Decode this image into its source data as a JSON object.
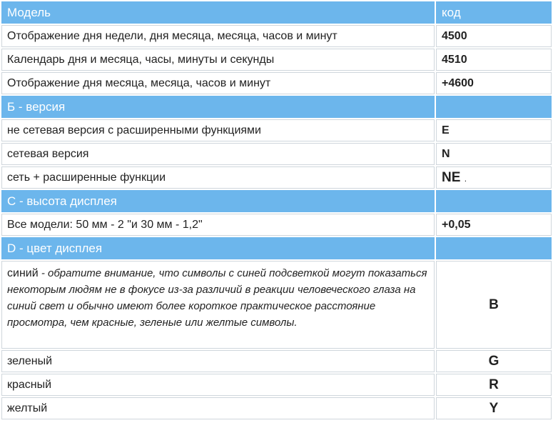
{
  "table": {
    "header": {
      "model": "Модель",
      "code": "код"
    },
    "models": [
      {
        "label": "Отображение дня недели, дня месяца, месяца, часов и минут",
        "code": "4500"
      },
      {
        "label": "Календарь дня и месяца, часы, минуты и секунды",
        "code": "4510"
      },
      {
        "label": "Отображение дня месяца, месяца, часов и минут",
        "code": "+4600"
      }
    ],
    "version_section": {
      "title": "Б - версия",
      "rows": [
        {
          "label": "не сетевая версия с расширенными функциями",
          "code": "E"
        },
        {
          "label": "сетевая версия",
          "code": "N"
        },
        {
          "label": "сеть + расширенные функции",
          "code": "NE",
          "suffix": "."
        }
      ]
    },
    "height_section": {
      "title": "С - высота дисплея",
      "rows": [
        {
          "label": "Все модели: 50 мм - 2 \"и 30 мм - 1,2\"",
          "code": "+0,05"
        }
      ]
    },
    "color_section": {
      "title": "D - цвет дисплея",
      "blue": {
        "label": "синий",
        "note": " - обратите внимание, что символы с синей подсветкой могут показаться некоторым людям не в фокусе из-за различий в реакции человеческого глаза на синий свет и обычно имеют более короткое практическое расстояние просмотра, чем красные, зеленые или желтые символы.",
        "code": "B"
      },
      "rows": [
        {
          "label": "зеленый",
          "code": "G"
        },
        {
          "label": "красный",
          "code": "R"
        },
        {
          "label": "желтый",
          "code": "Y"
        }
      ]
    }
  }
}
